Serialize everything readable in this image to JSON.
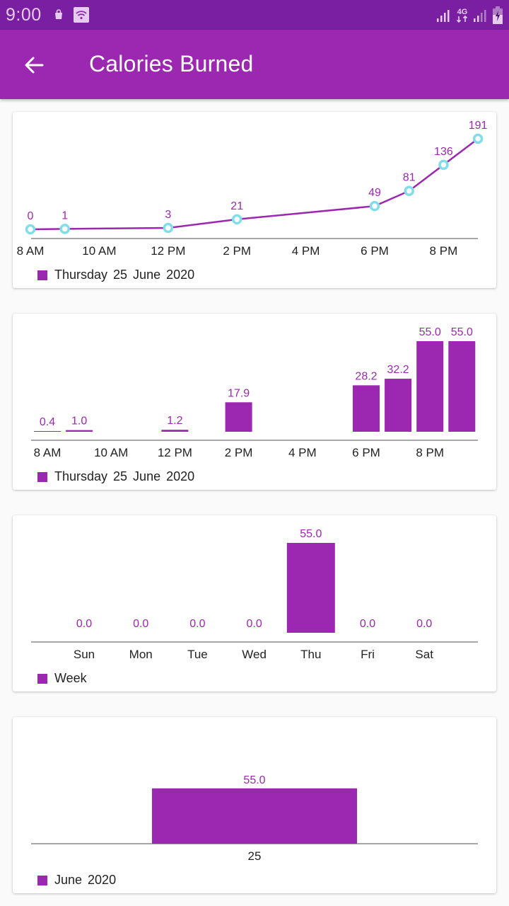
{
  "status_bar": {
    "time": "9:00",
    "left_icons": [
      "shopping-bag-icon",
      "wifi-icon"
    ],
    "right_icons": [
      "signal-icon",
      "network-4g-icon",
      "signal-weak-icon",
      "battery-charging-icon"
    ],
    "network_label": "4G"
  },
  "app_bar": {
    "title": "Calories Burned",
    "back_icon": "arrow-left-icon"
  },
  "colors": {
    "status_bar": "#7B1FA2",
    "app_bar": "#9C27B0",
    "series": "#9C27B0",
    "marker": "#80DEEA",
    "value_label": "#9C27B0",
    "background": "#FAFAFA"
  },
  "chart_data": [
    {
      "type": "line",
      "title": "",
      "xlabel": "",
      "ylabel": "",
      "x_ticks": [
        "8 AM",
        "10 AM",
        "12 PM",
        "2 PM",
        "4 PM",
        "6 PM",
        "8 PM"
      ],
      "x_hours": [
        8,
        9,
        12,
        14,
        18,
        19,
        20,
        21
      ],
      "values": [
        0,
        1,
        3,
        21,
        49,
        81,
        136,
        191
      ],
      "x_range_hours": [
        8,
        21
      ],
      "ylim": [
        0,
        191
      ],
      "grid": false,
      "legend": {
        "label": "Thursday 25 June 2020",
        "position": "bottom-left"
      }
    },
    {
      "type": "bar",
      "title": "",
      "xlabel": "",
      "ylabel": "",
      "x_ticks": [
        "8 AM",
        "10 AM",
        "12 PM",
        "2 PM",
        "4 PM",
        "6 PM",
        "8 PM"
      ],
      "x_hours": [
        8,
        9,
        12,
        14,
        18,
        19,
        20,
        21
      ],
      "values": [
        0.4,
        1.0,
        1.2,
        17.9,
        28.2,
        32.2,
        55.0,
        55.0
      ],
      "value_labels": [
        "0.4",
        "1.0",
        "1.2",
        "17.9",
        "28.2",
        "32.2",
        "55.0",
        "55.0"
      ],
      "x_range_hours": [
        8,
        21
      ],
      "ylim": [
        0,
        55
      ],
      "grid": false,
      "legend": {
        "label": "Thursday 25 June 2020",
        "position": "bottom-left"
      }
    },
    {
      "type": "bar",
      "title": "",
      "xlabel": "",
      "ylabel": "",
      "categories": [
        "Sun",
        "Mon",
        "Tue",
        "Wed",
        "Thu",
        "Fri",
        "Sat"
      ],
      "values": [
        0.0,
        0.0,
        0.0,
        0.0,
        55.0,
        0.0,
        0.0
      ],
      "value_labels": [
        "0.0",
        "0.0",
        "0.0",
        "0.0",
        "55.0",
        "0.0",
        "0.0"
      ],
      "ylim": [
        0,
        55
      ],
      "grid": false,
      "legend": {
        "label": "Week",
        "position": "bottom-left"
      }
    },
    {
      "type": "bar",
      "title": "",
      "xlabel": "",
      "ylabel": "",
      "categories": [
        "25"
      ],
      "values": [
        55.0
      ],
      "value_labels": [
        "55.0"
      ],
      "ylim": [
        0,
        90
      ],
      "grid": false,
      "legend": {
        "label": "June 2020",
        "position": "bottom-left"
      }
    }
  ]
}
